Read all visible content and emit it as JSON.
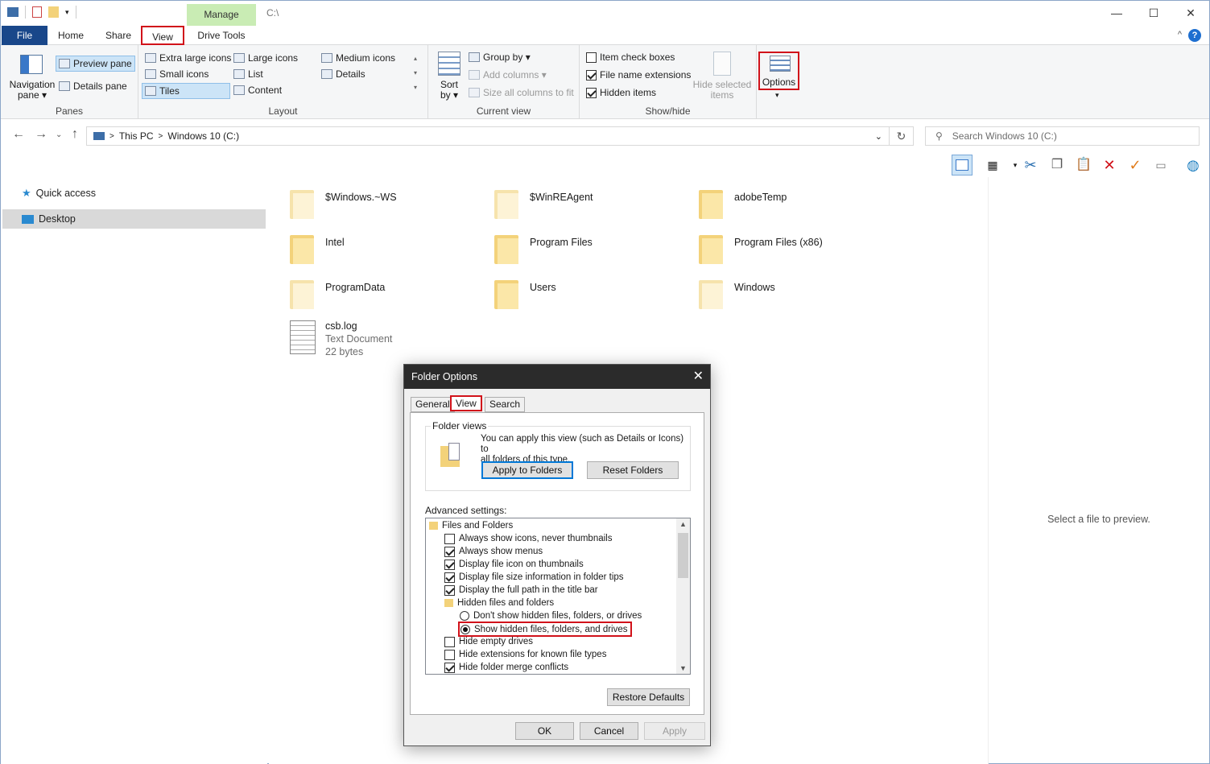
{
  "titlebar": {
    "manage_tab": "Manage",
    "path": "C:\\",
    "minimize": "—",
    "maximize": "☐",
    "close": "✕"
  },
  "tabs": {
    "file": "File",
    "home": "Home",
    "share": "Share",
    "view": "View",
    "drive_tools": "Drive Tools"
  },
  "ribbon": {
    "panes": {
      "label": "Panes",
      "navigation_pane": "Navigation",
      "navigation_pane_2": "pane ▾",
      "preview_pane": "Preview pane",
      "details_pane": "Details pane"
    },
    "layout": {
      "label": "Layout",
      "extra_large_icons": "Extra large icons",
      "large_icons": "Large icons",
      "medium_icons": "Medium icons",
      "small_icons": "Small icons",
      "list": "List",
      "details": "Details",
      "tiles": "Tiles",
      "content": "Content"
    },
    "current_view": {
      "label": "Current view",
      "sort": "Sort",
      "sort_2": "by ▾",
      "group_by": "Group by ▾",
      "add_columns": "Add columns ▾",
      "size_all_columns": "Size all columns to fit"
    },
    "show_hide": {
      "label": "Show/hide",
      "item_check_boxes": "Item check boxes",
      "file_name_extensions": "File name extensions",
      "hidden_items": "Hidden items",
      "hide_selected": "Hide selected",
      "hide_selected_2": "items"
    },
    "options": {
      "label": "Options",
      "arrow": "▾"
    }
  },
  "address": {
    "this_pc": "This PC",
    "drive": "Windows 10 (C:)",
    "search_placeholder": "Search Windows 10 (C:)"
  },
  "navpane": {
    "quick_access": "Quick access",
    "desktop": "Desktop"
  },
  "files": [
    {
      "name": "$Windows.~WS",
      "kind": "light"
    },
    {
      "name": "$WinREAgent",
      "kind": "light"
    },
    {
      "name": "adobeTemp",
      "kind": "normal"
    },
    {
      "name": "Intel",
      "kind": "normal"
    },
    {
      "name": "Program Files",
      "kind": "normal"
    },
    {
      "name": "Program Files (x86)",
      "kind": "normal"
    },
    {
      "name": "ProgramData",
      "kind": "light"
    },
    {
      "name": "Users",
      "kind": "normal"
    },
    {
      "name": "Windows",
      "kind": "light"
    }
  ],
  "doc": {
    "name": "csb.log",
    "type": "Text Document",
    "size": "22 bytes"
  },
  "preview": {
    "text": "Select a file to preview."
  },
  "dialog": {
    "title": "Folder Options",
    "tabs": {
      "general": "General",
      "view": "View",
      "search": "Search"
    },
    "folder_views": "Folder views",
    "folder_views_desc_1": "You can apply this view (such as Details or Icons) to",
    "folder_views_desc_2": "all folders of this type.",
    "apply_to_folders": "Apply to Folders",
    "reset_folders": "Reset Folders",
    "advanced_settings": "Advanced settings:",
    "tree": {
      "files_and_folders": "Files and Folders",
      "always_show_icons": "Always show icons, never thumbnails",
      "always_show_menus": "Always show menus",
      "display_file_icon": "Display file icon on thumbnails",
      "display_file_size": "Display file size information in folder tips",
      "display_full_path": "Display the full path in the title bar",
      "hidden_files_folders": "Hidden files and folders",
      "dont_show_hidden": "Don't show hidden files, folders, or drives",
      "show_hidden": "Show hidden files, folders, and drives",
      "hide_empty_drives": "Hide empty drives",
      "hide_extensions": "Hide extensions for known file types",
      "hide_folder_merge": "Hide folder merge conflicts"
    },
    "restore_defaults": "Restore Defaults",
    "ok": "OK",
    "cancel": "Cancel",
    "apply": "Apply"
  },
  "colors": {
    "file_tab": "#19478a",
    "highlight_red": "#d1121a",
    "manage_tab": "#c9ecb4",
    "dialog_title": "#2b2b2b"
  }
}
